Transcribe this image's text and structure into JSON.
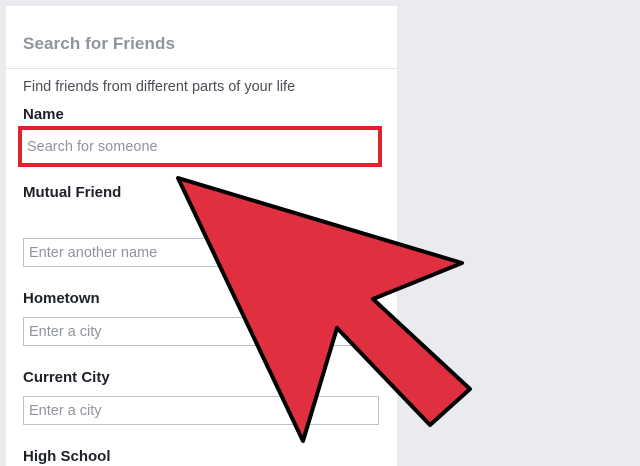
{
  "panel": {
    "title": "Search for Friends",
    "intro": "Find friends from different parts of your life"
  },
  "fields": {
    "name": {
      "label": "Name",
      "placeholder": "Search for someone",
      "value": ""
    },
    "mutual_friend": {
      "label": "Mutual Friend",
      "placeholder": "Enter another name",
      "value": ""
    },
    "hometown": {
      "label": "Hometown",
      "placeholder": "Enter a city",
      "value": ""
    },
    "current_city": {
      "label": "Current City",
      "placeholder": "Enter a city",
      "value": ""
    },
    "high_school": {
      "label": "High School"
    }
  },
  "annotation": {
    "highlight_color": "#e0212e",
    "arrow_color": "#e0303f",
    "arrow_outline_color": "#000000"
  }
}
